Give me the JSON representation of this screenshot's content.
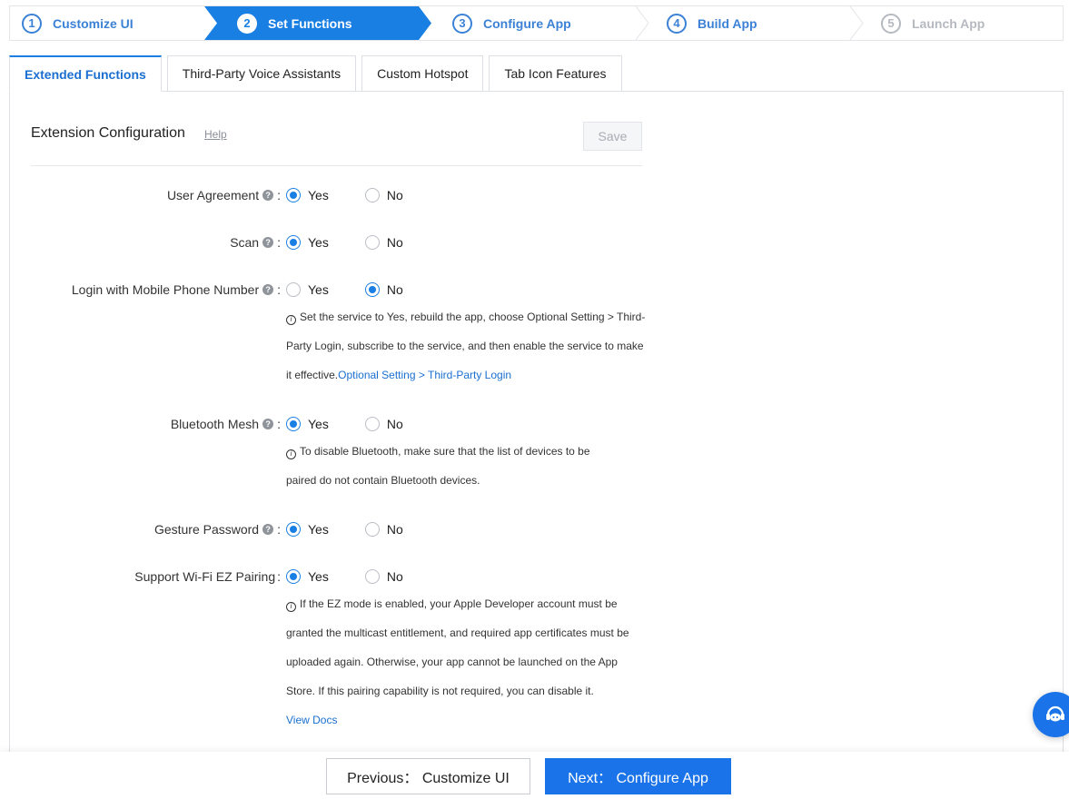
{
  "steps": [
    {
      "num": "1",
      "label": "Customize UI",
      "state": "done"
    },
    {
      "num": "2",
      "label": "Set Functions",
      "state": "active"
    },
    {
      "num": "3",
      "label": "Configure App",
      "state": "pending"
    },
    {
      "num": "4",
      "label": "Build App",
      "state": "pending"
    },
    {
      "num": "5",
      "label": "Launch App",
      "state": "disabled"
    }
  ],
  "tabs": [
    {
      "label": "Extended Functions",
      "active": true
    },
    {
      "label": "Third-Party Voice Assistants",
      "active": false
    },
    {
      "label": "Custom Hotspot",
      "active": false
    },
    {
      "label": "Tab Icon Features",
      "active": false
    }
  ],
  "panel": {
    "title": "Extension Configuration",
    "help": "Help",
    "save": "Save"
  },
  "options": {
    "yes": "Yes",
    "no": "No",
    "colon": ":"
  },
  "settings": [
    {
      "label": "User Agreement",
      "has_help": true,
      "value": "Yes"
    },
    {
      "label": "Scan",
      "has_help": true,
      "value": "Yes"
    },
    {
      "label": "Login with Mobile Phone Number",
      "has_help": true,
      "value": "No",
      "note": "Set the service to Yes, rebuild the app, choose Optional Setting > Third-Party Login, subscribe to the service, and then enable the service to make it effective.",
      "note_link": "Optional Setting > Third-Party Login"
    },
    {
      "label": "Bluetooth Mesh",
      "has_help": true,
      "value": "Yes",
      "note": "To disable Bluetooth, make sure that the list of devices to be paired do not contain Bluetooth devices."
    },
    {
      "label": "Gesture Password",
      "has_help": true,
      "value": "Yes"
    },
    {
      "label": "Support Wi-Fi EZ Pairing",
      "has_help": false,
      "value": "Yes",
      "note": "If the EZ mode is enabled, your Apple Developer account must be granted the multicast entitlement, and required app certificates must be uploaded again. Otherwise, your app cannot be launched on the App Store. If this pairing capability is not required, you can disable it.",
      "note_link": "View Docs"
    }
  ],
  "footer": {
    "prev": "Previous： Customize UI",
    "next": "Next： Configure App"
  },
  "colors": {
    "accent": "#1a7fe3",
    "link": "#1a6fd0",
    "disabled": "#b5b9c0"
  },
  "icons": {
    "help": "question-circle-icon",
    "info": "info-circle-icon",
    "chat": "customer-service-icon"
  }
}
